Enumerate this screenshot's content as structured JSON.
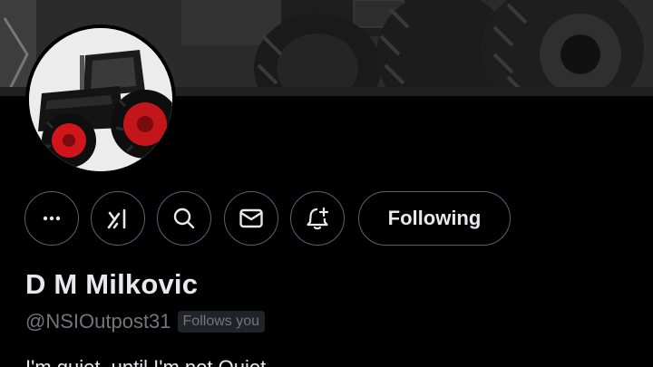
{
  "profile": {
    "display_name": "D M Milkovic",
    "handle": "@NSIOutpost31",
    "follows_you_badge": "Follows you",
    "bio": "I'm quiet, until I'm not Quiet."
  },
  "actions": {
    "more_icon": "more-dots-icon",
    "grok_icon": "grok-icon",
    "search_icon": "search-icon",
    "message_icon": "envelope-icon",
    "notify_icon": "bell-plus-icon",
    "following_label": "Following"
  },
  "colors": {
    "background": "#000000",
    "primary_text": "#e7e9ea",
    "secondary_text": "#71767b",
    "border": "#536471",
    "badge_bg": "#202327",
    "wheel_red": "#d0161b"
  }
}
